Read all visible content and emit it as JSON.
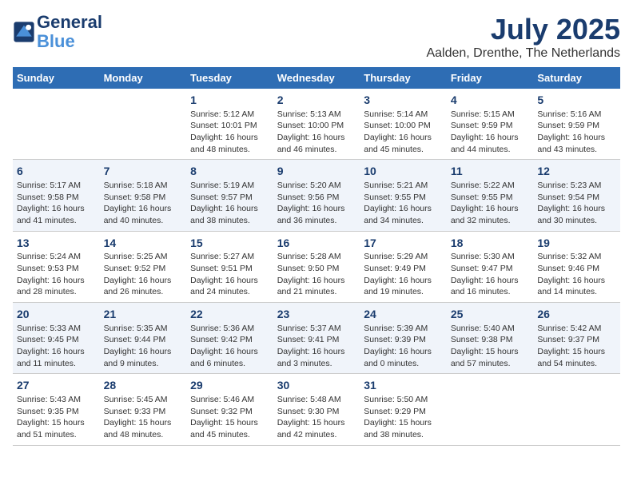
{
  "logo": {
    "line1": "General",
    "line2": "Blue"
  },
  "title": "July 2025",
  "subtitle": "Aalden, Drenthe, The Netherlands",
  "header_days": [
    "Sunday",
    "Monday",
    "Tuesday",
    "Wednesday",
    "Thursday",
    "Friday",
    "Saturday"
  ],
  "weeks": [
    [
      {
        "day": "",
        "info": ""
      },
      {
        "day": "",
        "info": ""
      },
      {
        "day": "1",
        "info": "Sunrise: 5:12 AM\nSunset: 10:01 PM\nDaylight: 16 hours and 48 minutes."
      },
      {
        "day": "2",
        "info": "Sunrise: 5:13 AM\nSunset: 10:00 PM\nDaylight: 16 hours and 46 minutes."
      },
      {
        "day": "3",
        "info": "Sunrise: 5:14 AM\nSunset: 10:00 PM\nDaylight: 16 hours and 45 minutes."
      },
      {
        "day": "4",
        "info": "Sunrise: 5:15 AM\nSunset: 9:59 PM\nDaylight: 16 hours and 44 minutes."
      },
      {
        "day": "5",
        "info": "Sunrise: 5:16 AM\nSunset: 9:59 PM\nDaylight: 16 hours and 43 minutes."
      }
    ],
    [
      {
        "day": "6",
        "info": "Sunrise: 5:17 AM\nSunset: 9:58 PM\nDaylight: 16 hours and 41 minutes."
      },
      {
        "day": "7",
        "info": "Sunrise: 5:18 AM\nSunset: 9:58 PM\nDaylight: 16 hours and 40 minutes."
      },
      {
        "day": "8",
        "info": "Sunrise: 5:19 AM\nSunset: 9:57 PM\nDaylight: 16 hours and 38 minutes."
      },
      {
        "day": "9",
        "info": "Sunrise: 5:20 AM\nSunset: 9:56 PM\nDaylight: 16 hours and 36 minutes."
      },
      {
        "day": "10",
        "info": "Sunrise: 5:21 AM\nSunset: 9:55 PM\nDaylight: 16 hours and 34 minutes."
      },
      {
        "day": "11",
        "info": "Sunrise: 5:22 AM\nSunset: 9:55 PM\nDaylight: 16 hours and 32 minutes."
      },
      {
        "day": "12",
        "info": "Sunrise: 5:23 AM\nSunset: 9:54 PM\nDaylight: 16 hours and 30 minutes."
      }
    ],
    [
      {
        "day": "13",
        "info": "Sunrise: 5:24 AM\nSunset: 9:53 PM\nDaylight: 16 hours and 28 minutes."
      },
      {
        "day": "14",
        "info": "Sunrise: 5:25 AM\nSunset: 9:52 PM\nDaylight: 16 hours and 26 minutes."
      },
      {
        "day": "15",
        "info": "Sunrise: 5:27 AM\nSunset: 9:51 PM\nDaylight: 16 hours and 24 minutes."
      },
      {
        "day": "16",
        "info": "Sunrise: 5:28 AM\nSunset: 9:50 PM\nDaylight: 16 hours and 21 minutes."
      },
      {
        "day": "17",
        "info": "Sunrise: 5:29 AM\nSunset: 9:49 PM\nDaylight: 16 hours and 19 minutes."
      },
      {
        "day": "18",
        "info": "Sunrise: 5:30 AM\nSunset: 9:47 PM\nDaylight: 16 hours and 16 minutes."
      },
      {
        "day": "19",
        "info": "Sunrise: 5:32 AM\nSunset: 9:46 PM\nDaylight: 16 hours and 14 minutes."
      }
    ],
    [
      {
        "day": "20",
        "info": "Sunrise: 5:33 AM\nSunset: 9:45 PM\nDaylight: 16 hours and 11 minutes."
      },
      {
        "day": "21",
        "info": "Sunrise: 5:35 AM\nSunset: 9:44 PM\nDaylight: 16 hours and 9 minutes."
      },
      {
        "day": "22",
        "info": "Sunrise: 5:36 AM\nSunset: 9:42 PM\nDaylight: 16 hours and 6 minutes."
      },
      {
        "day": "23",
        "info": "Sunrise: 5:37 AM\nSunset: 9:41 PM\nDaylight: 16 hours and 3 minutes."
      },
      {
        "day": "24",
        "info": "Sunrise: 5:39 AM\nSunset: 9:39 PM\nDaylight: 16 hours and 0 minutes."
      },
      {
        "day": "25",
        "info": "Sunrise: 5:40 AM\nSunset: 9:38 PM\nDaylight: 15 hours and 57 minutes."
      },
      {
        "day": "26",
        "info": "Sunrise: 5:42 AM\nSunset: 9:37 PM\nDaylight: 15 hours and 54 minutes."
      }
    ],
    [
      {
        "day": "27",
        "info": "Sunrise: 5:43 AM\nSunset: 9:35 PM\nDaylight: 15 hours and 51 minutes."
      },
      {
        "day": "28",
        "info": "Sunrise: 5:45 AM\nSunset: 9:33 PM\nDaylight: 15 hours and 48 minutes."
      },
      {
        "day": "29",
        "info": "Sunrise: 5:46 AM\nSunset: 9:32 PM\nDaylight: 15 hours and 45 minutes."
      },
      {
        "day": "30",
        "info": "Sunrise: 5:48 AM\nSunset: 9:30 PM\nDaylight: 15 hours and 42 minutes."
      },
      {
        "day": "31",
        "info": "Sunrise: 5:50 AM\nSunset: 9:29 PM\nDaylight: 15 hours and 38 minutes."
      },
      {
        "day": "",
        "info": ""
      },
      {
        "day": "",
        "info": ""
      }
    ]
  ]
}
